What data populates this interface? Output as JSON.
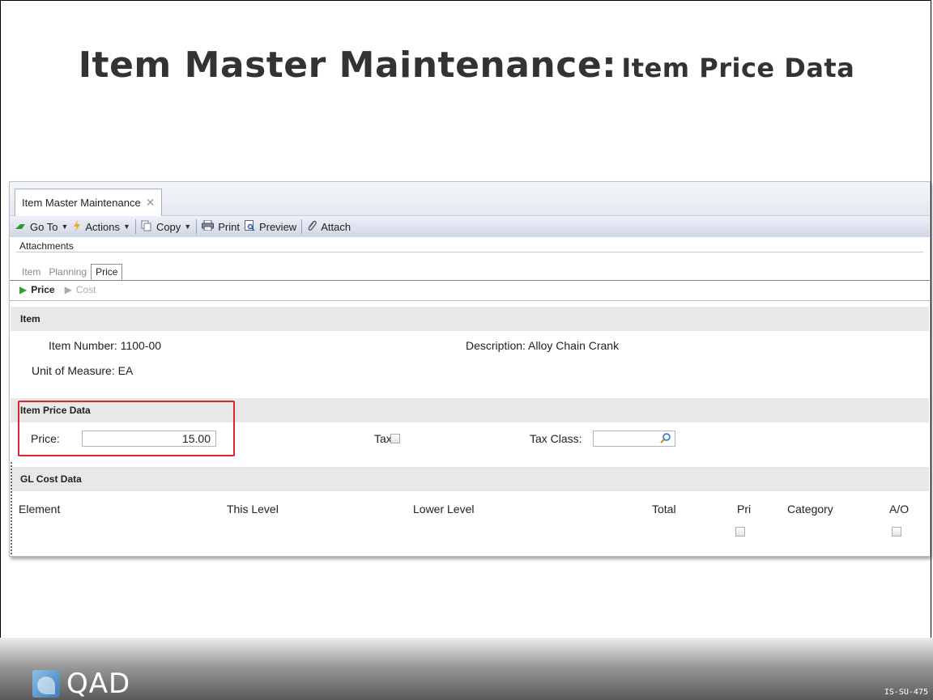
{
  "slide": {
    "title_main": "Item Master Maintenance:",
    "title_sub": "Item Price Data",
    "footer_logo": "QAD",
    "doc_code": "IS-SU-475"
  },
  "window": {
    "tab_label": "Item Master Maintenance",
    "toolbar": {
      "goto": "Go To",
      "actions": "Actions",
      "copy": "Copy",
      "print": "Print",
      "preview": "Preview",
      "attach": "Attach"
    },
    "attachments_label": "Attachments",
    "subtabs": [
      "Item",
      "Planning",
      "Price"
    ],
    "active_subtab": "Price",
    "nav": {
      "current": "Price",
      "next": "Cost"
    }
  },
  "item_section": {
    "header": "Item",
    "item_number_label": "Item Number:",
    "item_number": "1100-00",
    "description_label": "Description:",
    "description": "Alloy Chain Crank",
    "uom_label": "Unit of Measure:",
    "uom": "EA"
  },
  "price_section": {
    "header": "Item Price Data",
    "price_label": "Price:",
    "price": "15.00",
    "tax_label": "Tax:",
    "tax_checked": false,
    "tax_class_label": "Tax Class:",
    "tax_class": ""
  },
  "gl_section": {
    "header": "GL Cost Data",
    "columns": [
      "Element",
      "This Level",
      "Lower Level",
      "Total",
      "Pri",
      "Category",
      "A/O"
    ]
  },
  "colors": {
    "highlight": "#e0262b",
    "section_bg": "#e8e8e8",
    "toolbar_bg": "#cfd6e6"
  }
}
